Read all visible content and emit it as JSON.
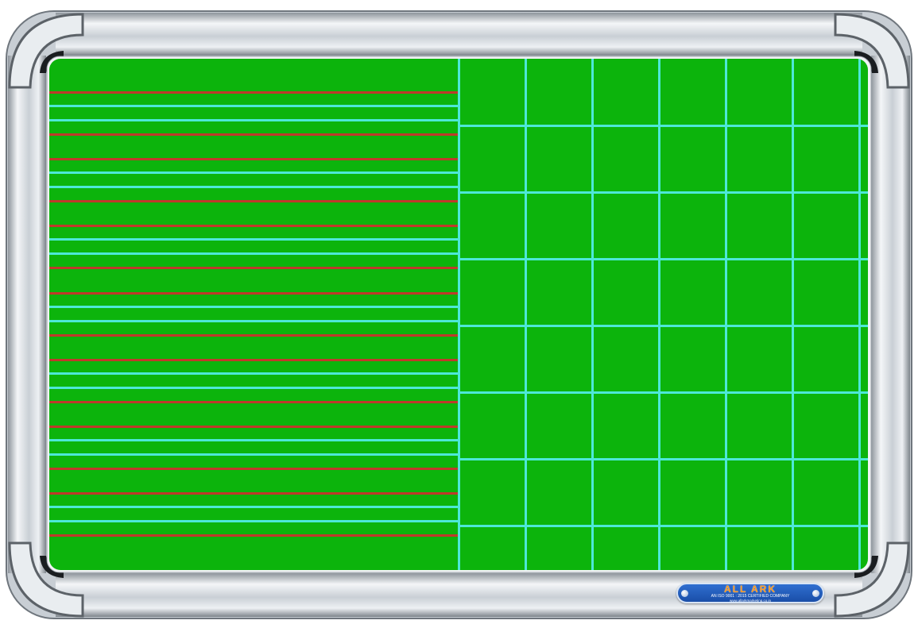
{
  "badge": {
    "brand": "ALL ARK",
    "tagline": "AN ISO 9001 : 2015 CERTIFIED COMPANY",
    "website": "www.allarkmarketing.co.in"
  },
  "colors": {
    "board_green": "#0cb40c",
    "rule_cyan": "#4de8d8",
    "rule_red": "#c0392b",
    "grid_cyan": "#4de8d8",
    "frame_aluminium": "#d6dbe0",
    "badge_blue": "#1f5cbf",
    "badge_brand_orange": "#ff9a1e"
  },
  "lines_panel": {
    "group_count": 7,
    "group_pattern": [
      "red",
      "cyan",
      "cyan",
      "red"
    ]
  },
  "grid_panel": {
    "columns": 6,
    "rows": 8
  }
}
